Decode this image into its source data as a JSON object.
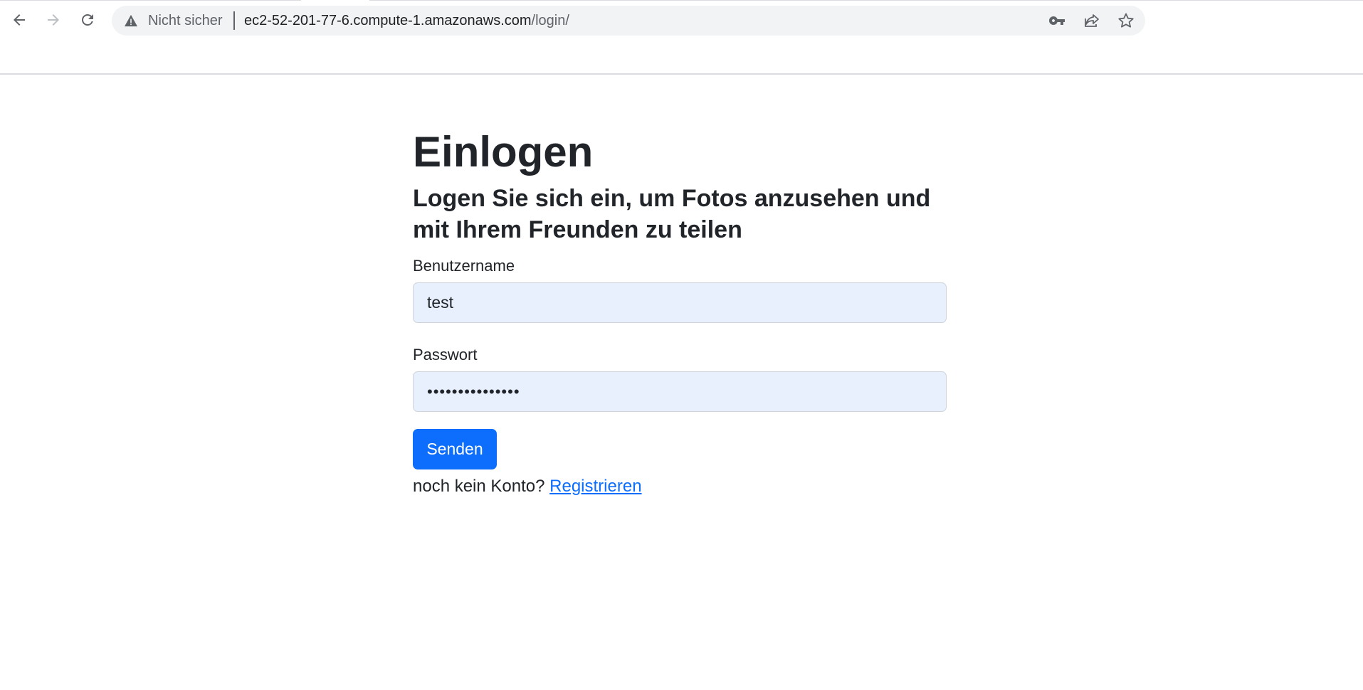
{
  "browser": {
    "security_label": "Nicht sicher",
    "url_host": "ec2-52-201-77-6.compute-1.amazonaws.com",
    "url_path": "/login/",
    "icons": [
      "back-arrow-icon",
      "forward-arrow-icon",
      "reload-icon",
      "warning-icon",
      "key-icon",
      "share-icon",
      "star-icon"
    ]
  },
  "page": {
    "title": "Einlogen",
    "subtitle": "Logen Sie sich ein, um Fotos anzusehen und mit Ihrem Freunden zu teilen",
    "username_label": "Benutzername",
    "username_value": "test",
    "password_label": "Passwort",
    "password_value": "•••••••••••••••",
    "submit_label": "Senden",
    "register_prompt": "noch kein Konto?",
    "register_link": "Registrieren"
  },
  "colors": {
    "primary": "#0d6efd",
    "autofill_bg": "#e8f0fe",
    "text": "#212529"
  }
}
